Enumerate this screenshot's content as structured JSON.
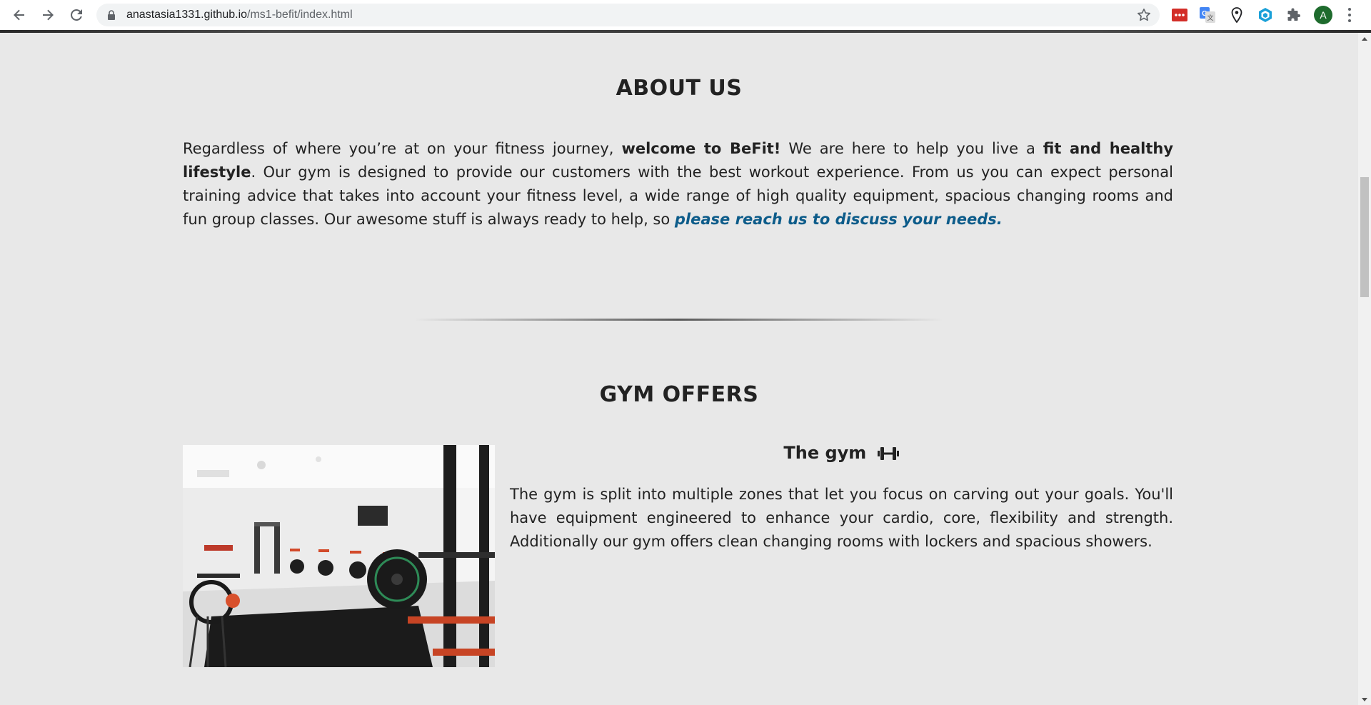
{
  "browser": {
    "url_host": "anastasia1331.github.io",
    "url_path": "/ms1-befit/index.html",
    "profile_initial": "A",
    "icons": {
      "back": "back-arrow-icon",
      "forward": "forward-arrow-icon",
      "reload": "reload-icon",
      "lock": "lock-icon",
      "bookmark": "star-icon",
      "extensions": [
        "lastpass-icon",
        "google-translate-icon",
        "location-pin-icon",
        "hexagon-extension-icon",
        "puzzle-extensions-icon"
      ],
      "menu": "more-vert-icon"
    }
  },
  "about": {
    "title": "ABOUT US",
    "p1": "Regardless of where you’re at on your fitness journey, ",
    "b1": "welcome to BeFit!",
    "p2": " We are here to help you live a ",
    "b2": "fit and healthy lifestyle",
    "p3": ". Our gym is designed to provide our customers with the best workout experience. From us you can expect personal training advice that takes into account your fitness level, a wide range of high quality equipment, spacious changing rooms and fun group classes. Our awesome stuff is always ready to help, so ",
    "cta": "please reach us to discuss your needs."
  },
  "offers": {
    "title": "GYM OFFERS",
    "items": [
      {
        "heading": "The gym",
        "icon": "dumbbell-icon",
        "text": "The gym is split into multiple zones that let you focus on carving out your goals. You'll have equipment engineered to enhance your cardio, core, flexibility and strength. Additionally our gym offers clean changing rooms with lockers and spacious showers."
      }
    ]
  },
  "colors": {
    "page_background": "#e8e8e8",
    "text": "#222222",
    "link": "#0d5c8a"
  }
}
